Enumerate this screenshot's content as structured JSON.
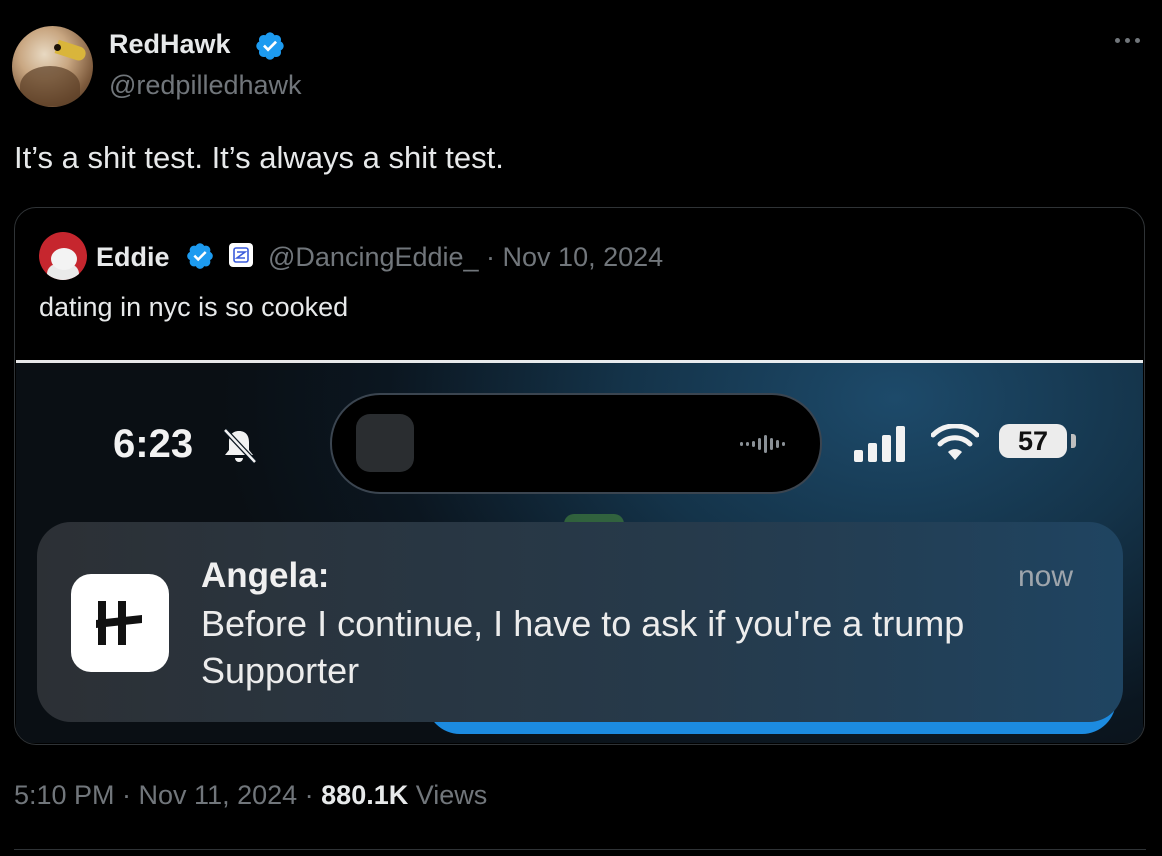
{
  "author": {
    "display_name": "RedHawk",
    "handle": "@redpilledhawk",
    "verified": true
  },
  "tweet": {
    "text": "It’s a shit test. It’s always a shit test."
  },
  "quoted": {
    "display_name": "Eddie",
    "handle_date": "@DancingEddie_ · Nov 10, 2024",
    "text": "dating in nyc is so cooked",
    "screenshot": {
      "time": "6:23",
      "battery": "57",
      "notification": {
        "sender": "Angela:",
        "time": "now",
        "message": "Before I continue, I have to ask if you're a trump Supporter"
      }
    }
  },
  "meta": {
    "timestamp": "5:10 PM · Nov 11, 2024 · ",
    "views_count": "880.1K",
    "views_label": " Views"
  },
  "colors": {
    "background": "#000000",
    "text": "#e7e9ea",
    "muted": "#71767b",
    "verified": "#1d9bf0",
    "border": "#2f3336"
  }
}
